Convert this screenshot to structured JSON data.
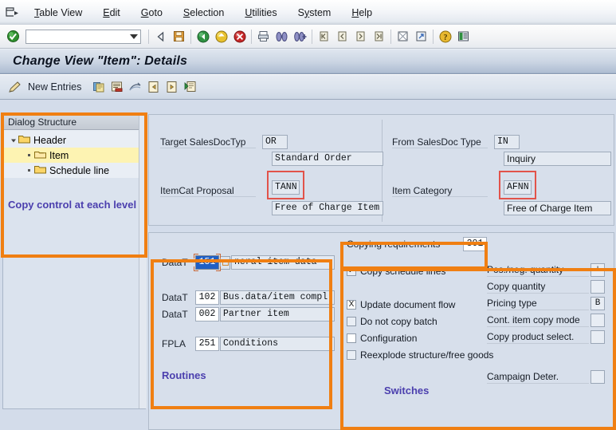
{
  "menu": {
    "logo_icon": "sap-table-icon",
    "items": [
      {
        "label": "Table View",
        "accel": "T"
      },
      {
        "label": "Edit",
        "accel": "E"
      },
      {
        "label": "Goto",
        "accel": "G"
      },
      {
        "label": "Selection",
        "accel": "S"
      },
      {
        "label": "Utilities",
        "accel": "U"
      },
      {
        "label": "System",
        "accel": "y"
      },
      {
        "label": "Help",
        "accel": "H"
      }
    ]
  },
  "system_toolbar": {
    "ok_icon": "green-check-icon",
    "command_field_value": "",
    "buttons": [
      {
        "name": "back-arrow-icon"
      },
      {
        "name": "save-floppy-icon"
      },
      {
        "name": "back-green-icon"
      },
      {
        "name": "exit-yellow-icon"
      },
      {
        "name": "cancel-red-icon"
      },
      {
        "name": "print-icon"
      },
      {
        "name": "find-icon"
      },
      {
        "name": "find-next-icon"
      },
      {
        "name": "first-page-icon"
      },
      {
        "name": "previous-page-icon"
      },
      {
        "name": "next-page-icon"
      },
      {
        "name": "last-page-icon"
      },
      {
        "name": "new-session-icon"
      },
      {
        "name": "create-shortcut-icon"
      },
      {
        "name": "help-question-icon"
      },
      {
        "name": "customize-layout-icon"
      }
    ]
  },
  "title": "Change View \"Item\": Details",
  "app_toolbar": {
    "pencil_icon": "pencil-edit-icon",
    "new_entries_label": "New Entries",
    "buttons": [
      {
        "name": "copy-as-icon"
      },
      {
        "name": "delete-row-icon"
      },
      {
        "name": "undo-icon"
      },
      {
        "name": "previous-entry-icon"
      },
      {
        "name": "next-entry-icon"
      },
      {
        "name": "variable-list-icon"
      }
    ]
  },
  "dialog_structure": {
    "header_label": "Dialog Structure",
    "nodes": [
      {
        "label": "Header",
        "level": 1,
        "selected": false,
        "expander": "triangle-down-icon",
        "icon": "folder-icon"
      },
      {
        "label": "Item",
        "level": 2,
        "selected": true,
        "expander": "bullet",
        "icon": "folder-open-icon"
      },
      {
        "label": "Schedule line",
        "level": 2,
        "selected": false,
        "expander": "bullet",
        "icon": "folder-icon"
      }
    ],
    "annotation": "Copy control at each level"
  },
  "top_panel": {
    "left": {
      "target_salesdoctyp_label": "Target SalesDocTyp",
      "target_salesdoctyp_value": "OR",
      "target_salesdoctyp_text": "Standard Order",
      "itemcat_proposal_label": "ItemCat Proposal",
      "itemcat_proposal_value": "TANN",
      "itemcat_proposal_text": "Free of Charge Item"
    },
    "right": {
      "from_salesdoc_type_label": "From SalesDoc Type",
      "from_salesdoc_type_value": "IN",
      "from_salesdoc_type_text": "Inquiry",
      "item_category_label": "Item Category",
      "item_category_value": "AFNN",
      "item_category_text": "Free of Charge Item"
    }
  },
  "routines": {
    "section_label": "Routines",
    "rows": [
      {
        "label": "DataT",
        "value": "151",
        "text": "neral item data",
        "focused": true,
        "matchcode": true
      },
      {
        "label": "DataT",
        "value": "102",
        "text": "Bus.data/item compl.",
        "focused": false,
        "matchcode": false
      },
      {
        "label": "DataT",
        "value": "002",
        "text": "Partner item",
        "focused": false,
        "matchcode": false
      },
      {
        "label": "FPLA",
        "value": "251",
        "text": "Conditions",
        "focused": false,
        "matchcode": false
      }
    ]
  },
  "copying_requirements": {
    "label": "Copying requirements",
    "value": "301"
  },
  "switches": {
    "section_label": "Switches",
    "checkboxes": [
      {
        "label": "Copy schedule lines",
        "state": "checked",
        "glyph": "✓"
      },
      {
        "label": "Update document flow",
        "state": "x",
        "glyph": "X"
      },
      {
        "label": "Do not copy batch",
        "state": "unchecked",
        "glyph": ""
      },
      {
        "label": "Configuration",
        "state": "unchecked-white",
        "glyph": ""
      },
      {
        "label": "Reexplode structure/free goods",
        "state": "unchecked",
        "glyph": ""
      }
    ],
    "fields": [
      {
        "label": "Pos./neg. quantity",
        "value": "+"
      },
      {
        "label": "Copy quantity",
        "value": ""
      },
      {
        "label": "Pricing type",
        "value": "B"
      },
      {
        "label": "Cont. item copy mode",
        "value": ""
      },
      {
        "label": "Copy product select.",
        "value": ""
      },
      {
        "label": "Campaign Deter.",
        "value": ""
      }
    ]
  },
  "colors": {
    "highlight_orange": "#f07f12",
    "red_box": "#e2534a",
    "annotation_purple": "#4b3fae",
    "focus_blue": "#1f5fc4"
  }
}
